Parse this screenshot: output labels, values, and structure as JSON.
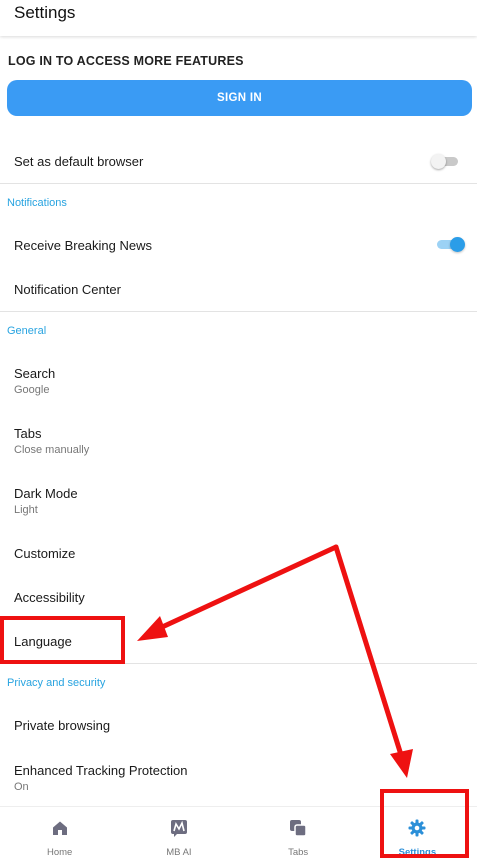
{
  "header": {
    "title": "Settings"
  },
  "login": {
    "title": "LOG IN TO ACCESS MORE FEATURES",
    "button": "SIGN IN"
  },
  "default_browser": {
    "label": "Set as default browser",
    "enabled": false
  },
  "notifications": {
    "section": "Notifications",
    "breaking_news": {
      "label": "Receive Breaking News",
      "enabled": true
    },
    "center": {
      "label": "Notification Center"
    }
  },
  "general": {
    "section": "General",
    "search": {
      "label": "Search",
      "value": "Google"
    },
    "tabs": {
      "label": "Tabs",
      "value": "Close manually"
    },
    "dark_mode": {
      "label": "Dark Mode",
      "value": "Light"
    },
    "customize": {
      "label": "Customize"
    },
    "accessibility": {
      "label": "Accessibility"
    },
    "language": {
      "label": "Language"
    }
  },
  "privacy": {
    "section": "Privacy and security",
    "private_browsing": {
      "label": "Private browsing"
    },
    "tracking": {
      "label": "Enhanced Tracking Protection",
      "value": "On"
    }
  },
  "bottom_nav": {
    "items": [
      {
        "label": "Home",
        "icon": "home-icon"
      },
      {
        "label": "MB AI",
        "icon": "mb-ai-icon"
      },
      {
        "label": "Tabs",
        "icon": "tabs-icon"
      },
      {
        "label": "Settings",
        "icon": "gear-icon",
        "active": true
      }
    ]
  },
  "colors": {
    "accent": "#3a9bf4",
    "section": "#27a3e0",
    "annotation": "#ee1111"
  }
}
